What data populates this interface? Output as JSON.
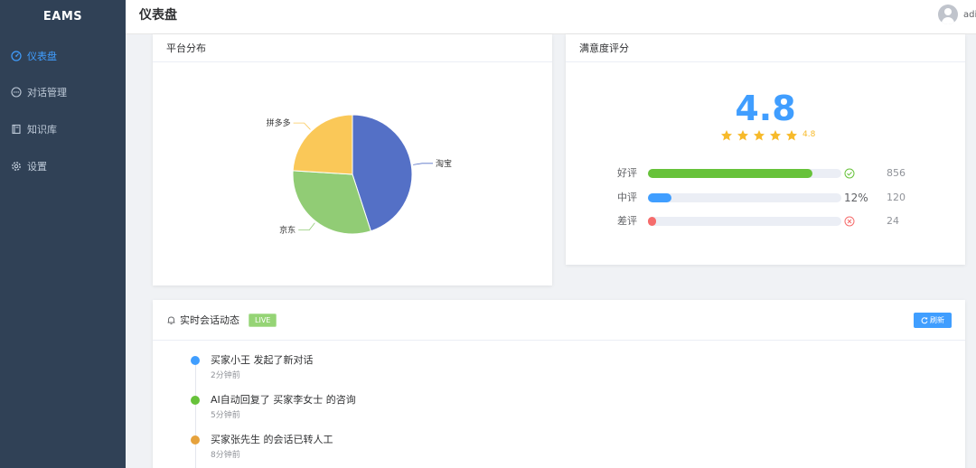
{
  "app": {
    "brand": "EAMS"
  },
  "sidebar": {
    "items": [
      {
        "label": "仪表盘",
        "icon": "dashboard-icon",
        "active": true
      },
      {
        "label": "对话管理",
        "icon": "chat-icon",
        "active": false
      },
      {
        "label": "知识库",
        "icon": "book-icon",
        "active": false
      },
      {
        "label": "设置",
        "icon": "gear-icon",
        "active": false
      }
    ]
  },
  "header": {
    "title": "仪表盘",
    "username": "adi"
  },
  "pie_card": {
    "title": "平台分布"
  },
  "chart_data": {
    "type": "pie",
    "categories": [
      "淘宝",
      "京东",
      "拼多多"
    ],
    "values": [
      45,
      31,
      24
    ],
    "colors": [
      "#5470c6",
      "#91cc75",
      "#fac858"
    ]
  },
  "rating_card": {
    "title": "满意度评分",
    "score": "4.8",
    "stars_value": "4.8",
    "star_rating": 4.8,
    "star_color": "#f7ba2a",
    "rows": [
      {
        "label": "好评",
        "fill": 0.85,
        "color": "#67c23a",
        "status_icon": "check-circle-icon",
        "status": "",
        "count": "856"
      },
      {
        "label": "中评",
        "fill": 0.12,
        "color": "#409eff",
        "status_icon": "",
        "status": "12%",
        "count": "120"
      },
      {
        "label": "差评",
        "fill": 0.02,
        "color": "#f56c6c",
        "status_icon": "close-circle-icon",
        "status": "",
        "count": "24"
      }
    ]
  },
  "live_card": {
    "title": "实时会话动态",
    "tag": "LIVE",
    "refresh_label": "刷新",
    "events": [
      {
        "text": "买家小王 发起了新对话",
        "time": "2分钟前",
        "color": "#409eff"
      },
      {
        "text": "AI自动回复了 买家李女士 的咨询",
        "time": "5分钟前",
        "color": "#67c23a"
      },
      {
        "text": "买家张先生 的会话已转人工",
        "time": "8分钟前",
        "color": "#e6a23c"
      }
    ]
  }
}
